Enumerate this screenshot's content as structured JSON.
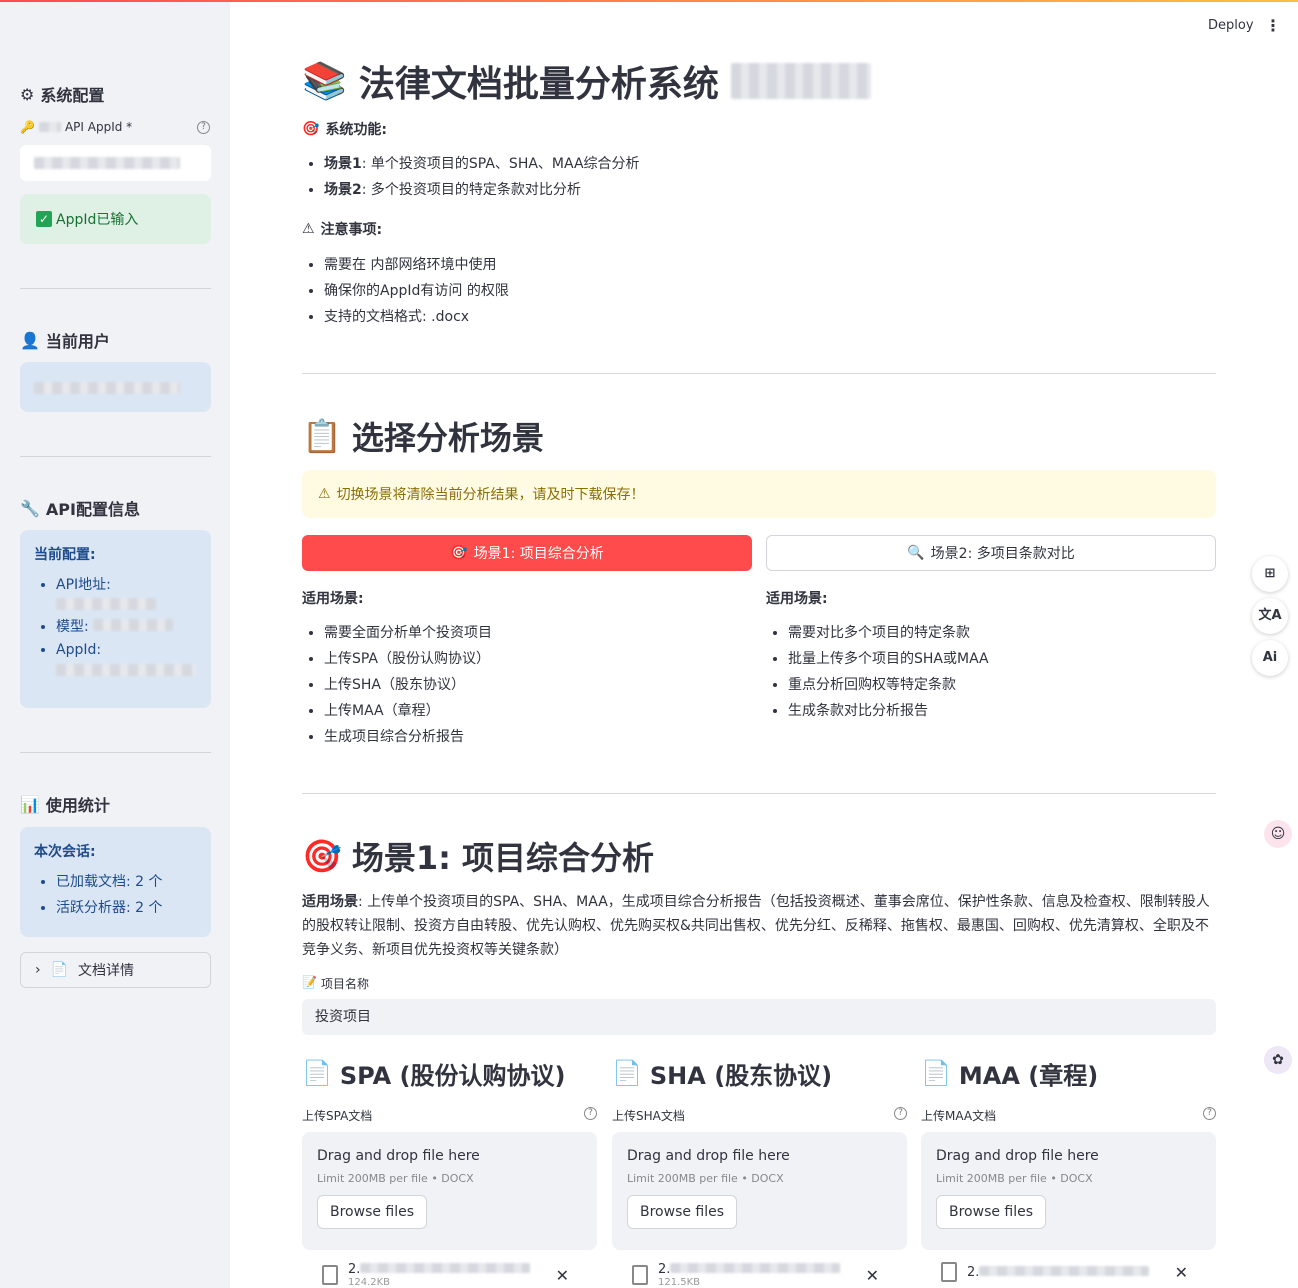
{
  "header": {
    "deploy_label": "Deploy",
    "menu_icon": "⋮"
  },
  "sidebar": {
    "system_config_title": "系统配置",
    "api_appid_label": "API AppId *",
    "appid_status": "AppId已输入",
    "current_user_title": "当前用户",
    "api_info_title": "API配置信息",
    "api_info_heading": "当前配置:",
    "api_info_items": [
      "API地址:",
      "模型:",
      "AppId:"
    ],
    "usage_title": "使用统计",
    "session_heading": "本次会话:",
    "session_items": [
      "已加载文档: 2 个",
      "活跃分析器: 2 个"
    ],
    "doc_details": "文档详情"
  },
  "main": {
    "title": "法律文档批量分析系统",
    "features_title": "系统功能:",
    "features": [
      {
        "bold": "场景1",
        "text": ": 单个投资项目的SPA、SHA、MAA综合分析"
      },
      {
        "bold": "场景2",
        "text": ": 多个投资项目的特定条款对比分析"
      }
    ],
    "notes_title": "注意事项:",
    "notes": [
      "需要在     内部网络环境中使用",
      "确保你的AppId有访问                      的权限",
      "支持的文档格式: .docx"
    ],
    "select_title": "选择分析场景",
    "warning": "切换场景将清除当前分析结果，请及时下载保存！",
    "scenario1_button": "场景1: 项目综合分析",
    "scenario2_button": "场景2: 多项目条款对比",
    "applicable_label": "适用场景:",
    "scenario1_items": [
      "需要全面分析单个投资项目",
      "上传SPA（股份认购协议）",
      "上传SHA（股东协议）",
      "上传MAA（章程）",
      "生成项目综合分析报告"
    ],
    "scenario2_items": [
      "需要对比多个项目的特定条款",
      "批量上传多个项目的SHA或MAA",
      "重点分析回购权等特定条款",
      "生成条款对比分析报告"
    ],
    "scenario1_title": "场景1: 项目综合分析",
    "scenario1_desc_bold": "适用场景",
    "scenario1_desc": ": 上传单个投资项目的SPA、SHA、MAA，生成项目综合分析报告（包括投资概述、董事会席位、保护性条款、信息及检查权、限制转股人的股权转让限制、投资方自由转股、优先认购权、优先购买权&共同出售权、优先分红、反稀释、拖售权、最惠国、回购权、优先清算权、全职及不竞争义务、新项目优先投资权等关键条款）",
    "project_name_label": "项目名称",
    "project_name_value": "投资项目",
    "uploads": [
      {
        "title": "SPA (股份认购协议)",
        "label": "上传SPA文档",
        "file_name": "2.",
        "file_size": "124.2KB"
      },
      {
        "title": "SHA (股东协议)",
        "label": "上传SHA文档",
        "file_name": "2.",
        "file_size": "121.5KB"
      },
      {
        "title": "MAA (章程)",
        "label": "上传MAA文档",
        "file_name": "",
        "file_size": ""
      }
    ],
    "dropzone_title": "Drag and drop file here",
    "dropzone_sub": "Limit 200MB per file • DOCX",
    "browse_label": "Browse files"
  },
  "right_tools": [
    "⊞",
    "文A",
    "Ai"
  ],
  "colors": {
    "primary": "#ff4b4b",
    "sidebar_bg": "#f0f2f6",
    "info_bg": "#dbe6f5",
    "success_bg": "#dff0e4",
    "warning_bg": "#fffbe2"
  }
}
